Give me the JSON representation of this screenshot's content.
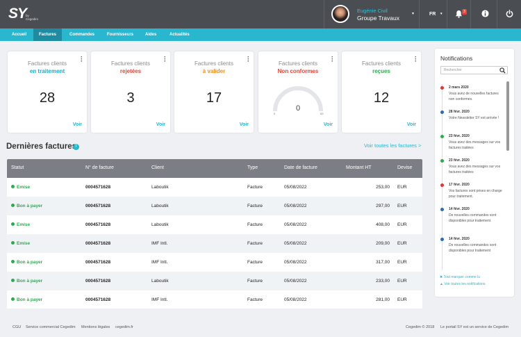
{
  "header": {
    "logo_text": "SY",
    "logo_sub_by": "by",
    "logo_sub_brand": "Cegedim",
    "user_name": "Eugénie Civil",
    "user_company": "Groupe Travaux",
    "language": "FR",
    "notification_count": "3",
    "icons": [
      "user-avatar",
      "bell-icon",
      "info-icon",
      "power-icon"
    ]
  },
  "nav": {
    "items": [
      "Accueil",
      "Factures",
      "Commandes",
      "Fournisseurs",
      "Aides",
      "Actualités"
    ],
    "active": "Factures"
  },
  "cards": [
    {
      "label": "Factures clients",
      "status": "en traitement",
      "status_color": "#1ba9c4",
      "count": "28",
      "link": "Voir"
    },
    {
      "label": "Factures clients",
      "status": "rejetées",
      "status_color": "#e0463b",
      "count": "3",
      "link": "Voir"
    },
    {
      "label": "Factures clients",
      "status": "à valider",
      "status_color": "#f08c1a",
      "count": "17",
      "link": "Voir"
    },
    {
      "label": "Factures clients",
      "status": "Non conformes",
      "status_color": "#e0463b",
      "count": "0",
      "gauge_min": "0",
      "gauge_max": "63",
      "gauge_fraction": 0,
      "link": "Voir"
    },
    {
      "label": "Factures clients",
      "status": "reçues",
      "status_color": "#32a852",
      "count": "12",
      "link": "Voir"
    }
  ],
  "latest": {
    "title": "Dernières factures",
    "see_all": "Voir toutes les factures >",
    "columns": [
      "Statut",
      "N° de facture",
      "Client",
      "Type",
      "Date de facture",
      "Montant HT",
      "Devise"
    ],
    "rows": [
      {
        "status": "Emise",
        "invoice": "0004571628",
        "client": "Laboutik",
        "type": "Facture",
        "date": "05/08/2022",
        "amount": "253,00",
        "currency": "EUR"
      },
      {
        "status": "Bon à payer",
        "invoice": "0004571628",
        "client": "Laboutik",
        "type": "Facture",
        "date": "05/08/2022",
        "amount": "297,00",
        "currency": "EUR"
      },
      {
        "status": "Emise",
        "invoice": "0004571628",
        "client": "Laboutik",
        "type": "Facture",
        "date": "05/08/2022",
        "amount": "408,00",
        "currency": "EUR"
      },
      {
        "status": "Emise",
        "invoice": "0004571628",
        "client": "IMF Intl.",
        "type": "Facture",
        "date": "05/08/2022",
        "amount": "209,00",
        "currency": "EUR"
      },
      {
        "status": "Bon à payer",
        "invoice": "0004571628",
        "client": "IMF Intl.",
        "type": "Facture",
        "date": "05/08/2022",
        "amount": "317,00",
        "currency": "EUR"
      },
      {
        "status": "Bon à payer",
        "invoice": "0004571628",
        "client": "Laboutik",
        "type": "Facture",
        "date": "05/08/2022",
        "amount": "233,00",
        "currency": "EUR"
      },
      {
        "status": "Bon à payer",
        "invoice": "0004571628",
        "client": "IMF Intl.",
        "type": "Facture",
        "date": "05/08/2022",
        "amount": "281,00",
        "currency": "EUR"
      }
    ]
  },
  "notifications": {
    "title": "Notifications",
    "search_placeholder": "Rechercher",
    "items": [
      {
        "date": "2 mars 2020",
        "text": "Vous avez de nouvelles factures non conformes.",
        "color": "#d63b33"
      },
      {
        "date": "28 févr. 2020",
        "text": "Votre Newsletter SY est arrivée !",
        "color": "#2a6db5"
      },
      {
        "date": "23 févr. 2020",
        "text": "Vous avez des messages sur vos factures traitées",
        "color": "#32a852"
      },
      {
        "date": "23 févr. 2020",
        "text": "Vous avez des messages sur vos factures traitées",
        "color": "#32a852"
      },
      {
        "date": "17 févr. 2020",
        "text": "Vos factures sont prises en charge pour traitement.",
        "color": "#d63b33"
      },
      {
        "date": "14 févr. 2020",
        "text": "De nouvelles commandes sont disponibles pour traitement",
        "color": "#2a6db5"
      },
      {
        "date": "14 févr. 2020",
        "text": "De nouvelles commandes sont disponibles pour traitement",
        "color": "#2a6db5"
      }
    ],
    "mark_all": "Tout marquer comme lu",
    "see_all": "Voir toutes les notifications"
  },
  "footer": {
    "links": [
      "CGU",
      "Service commercial Cegedim",
      "Mentions légales",
      "cegedim.fr"
    ],
    "copyright": "Cegedim © 2018",
    "service": "Le portail SY est un service de Cegedim"
  }
}
